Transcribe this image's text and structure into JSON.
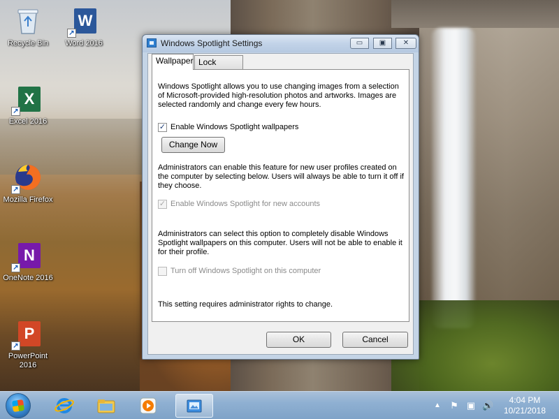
{
  "desktop": {
    "icons": [
      {
        "label": "Recycle Bin",
        "icon": "recycle-bin-icon"
      },
      {
        "label": "Word 2016",
        "icon": "word-icon",
        "letter": "W",
        "color": "#2b579a"
      },
      {
        "label": "Excel 2016",
        "icon": "excel-icon",
        "letter": "X",
        "color": "#217346"
      },
      {
        "label": "Mozilla Firefox",
        "icon": "firefox-icon"
      },
      {
        "label": "OneNote 2016",
        "icon": "onenote-icon",
        "letter": "N",
        "color": "#7719aa"
      },
      {
        "label": "PowerPoint 2016",
        "icon": "powerpoint-icon",
        "letter": "P",
        "color": "#d24726"
      }
    ]
  },
  "dialog": {
    "title": "Windows Spotlight Settings",
    "caption_buttons": {
      "minimize": "▭",
      "maximize": "▣",
      "close": "✕"
    },
    "tabs": [
      {
        "label": "Wallpaper",
        "active": true
      },
      {
        "label": "Lock Screen",
        "active": false
      }
    ],
    "intro_text": "Windows Spotlight allows you to use changing images from a selection of Microsoft-provided high-resolution photos and artworks. Images are selected randomly and change every few hours.",
    "enable_wallpapers": {
      "label": "Enable Windows Spotlight wallpapers",
      "checked": true,
      "mark": "✓"
    },
    "change_now_label": "Change Now",
    "admin_text_1": "Administrators can enable this feature for new user profiles created on the computer by selecting below. Users will always be able to turn it off if they choose.",
    "enable_new_accounts": {
      "label": "Enable Windows Spotlight for new accounts",
      "checked": true,
      "disabled": true,
      "mark": "✓"
    },
    "admin_text_2": "Administrators can select this option to completely disable Windows Spotlight wallpapers on this computer. Users will not be able to enable it for their profile.",
    "turn_off": {
      "label": "Turn off Windows Spotlight on this computer",
      "checked": false,
      "disabled": true
    },
    "footer_note": "This setting requires administrator rights to change.",
    "ok_label": "OK",
    "cancel_label": "Cancel"
  },
  "taskbar": {
    "pinned": [
      {
        "name": "internet-explorer-icon"
      },
      {
        "name": "file-explorer-icon"
      },
      {
        "name": "media-player-icon"
      },
      {
        "name": "spotlight-settings-icon",
        "active": true
      }
    ],
    "tray": {
      "show_hidden": "▲",
      "action_center": "⚑",
      "network": "▣",
      "volume": "🔊"
    },
    "clock": {
      "time": "4:04 PM",
      "date": "10/21/2018"
    }
  }
}
